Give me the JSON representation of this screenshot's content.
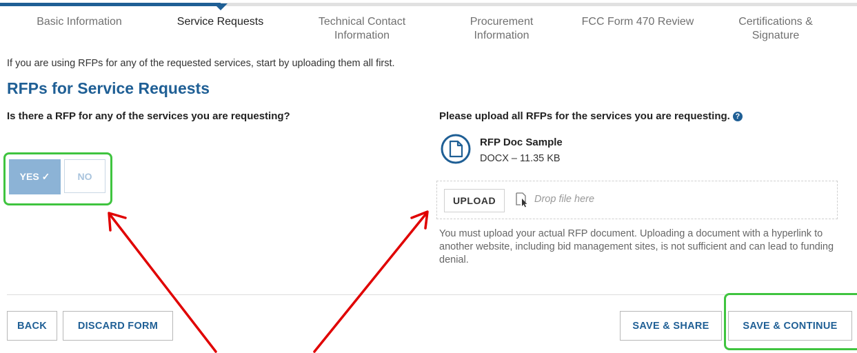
{
  "wizard": {
    "steps": [
      {
        "label": "Basic Information"
      },
      {
        "label": "Service Requests"
      },
      {
        "label": "Technical Contact Information"
      },
      {
        "label": "Procurement Information"
      },
      {
        "label": "FCC Form 470 Review"
      },
      {
        "label": "Certifications & Signature"
      }
    ],
    "active_step": "Service Requests"
  },
  "intro_text": "If you are using RFPs for any of the requested services, start by uploading them all first.",
  "section_title": "RFPs for Service Requests",
  "rfp_question": {
    "label": "Is there a RFP for any of the services you are requesting?",
    "yes_label": "YES ✓",
    "no_label": "NO",
    "selected": "YES"
  },
  "upload": {
    "title": "Please upload all RFPs for the services you are requesting.",
    "help_icon": "?",
    "file": {
      "name": "RFP Doc Sample",
      "meta": "DOCX – 11.35 KB"
    },
    "upload_button": "UPLOAD",
    "drop_text": "Drop file here",
    "warning": "You must upload your actual RFP document. Uploading a document with a hyperlink to another website, including bid management sites, is not sufficient and can lead to funding denial."
  },
  "actions": {
    "back": "BACK",
    "discard": "DISCARD FORM",
    "save_share": "SAVE & SHARE",
    "save_continue": "SAVE & CONTINUE"
  },
  "colors": {
    "brand_blue": "#1f5f95",
    "yes_selected": "#8cb3d6",
    "highlight_green": "#3fc43f",
    "annotation_red": "#e00000"
  },
  "icons": {
    "file": "document-icon",
    "drop": "drag-pointer-icon",
    "help": "question-circle-icon"
  }
}
